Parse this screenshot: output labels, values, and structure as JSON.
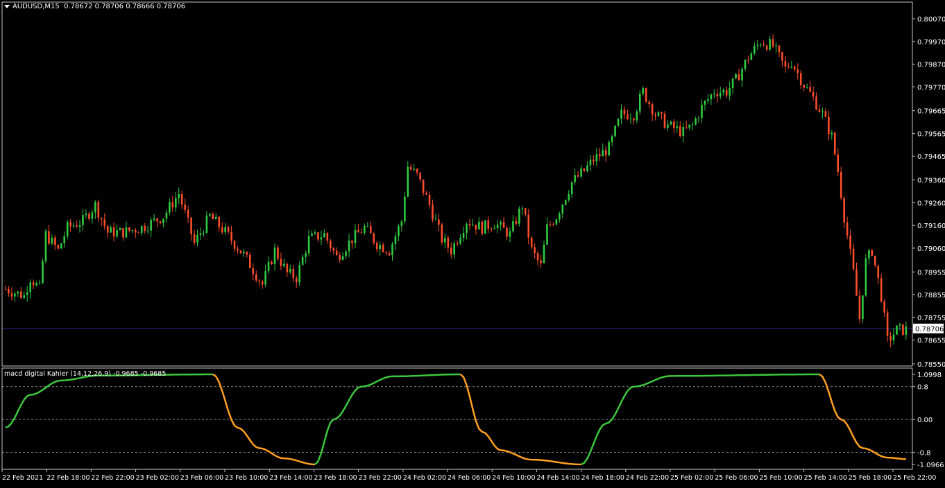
{
  "header": {
    "symbol": "AUDUSD,M15",
    "ohlc": "0.78672 0.78706 0.78666 0.78706"
  },
  "indicator": {
    "label": "macd digital Kahler (14,12,26,9) -0.9685 -0.9685"
  },
  "colors": {
    "background": "#000000",
    "frame": "#c8c8c8",
    "bull_candle": "#2ecc40",
    "bear_candle": "#ff4d2a",
    "price_line": "#2a2a8a",
    "macd_up": "#3cc83c",
    "macd_down": "#ffa020",
    "level_lines": "#8a8a8a"
  },
  "chart_data": [
    {
      "type": "candlestick",
      "title": "AUDUSD,M15",
      "y_ticks": [
        "0.80070",
        "0.79970",
        "0.79870",
        "0.79770",
        "0.79665",
        "0.79565",
        "0.79465",
        "0.79360",
        "0.79260",
        "0.79160",
        "0.79060",
        "0.78955",
        "0.78855",
        "0.78755",
        "0.78655",
        "0.78550"
      ],
      "ylim": [
        0.7855,
        0.8007
      ],
      "current_price": "0.78706",
      "x_ticks": [
        "22 Feb 2021",
        "22 Feb 18:00",
        "22 Feb 22:00",
        "23 Feb 02:00",
        "23 Feb 06:00",
        "23 Feb 10:00",
        "23 Feb 14:00",
        "23 Feb 18:00",
        "23 Feb 22:00",
        "24 Feb 02:00",
        "24 Feb 06:00",
        "24 Feb 10:00",
        "24 Feb 14:00",
        "24 Feb 18:00",
        "24 Feb 22:00",
        "25 Feb 02:00",
        "25 Feb 06:00",
        "25 Feb 10:00",
        "25 Feb 14:00",
        "25 Feb 18:00",
        "25 Feb 22:00"
      ],
      "close_path": [
        [
          0,
          0.7888
        ],
        [
          6,
          0.7885
        ],
        [
          8,
          0.7893
        ],
        [
          11,
          0.7888
        ],
        [
          13,
          0.7912
        ],
        [
          17,
          0.7905
        ],
        [
          20,
          0.7915
        ],
        [
          25,
          0.7918
        ],
        [
          29,
          0.7925
        ],
        [
          33,
          0.7913
        ],
        [
          38,
          0.7913
        ],
        [
          44,
          0.7915
        ],
        [
          51,
          0.792
        ],
        [
          56,
          0.793
        ],
        [
          61,
          0.7908
        ],
        [
          66,
          0.792
        ],
        [
          71,
          0.7913
        ],
        [
          77,
          0.7903
        ],
        [
          83,
          0.789
        ],
        [
          87,
          0.7905
        ],
        [
          91,
          0.7895
        ],
        [
          94,
          0.7893
        ],
        [
          98,
          0.791
        ],
        [
          103,
          0.7912
        ],
        [
          107,
          0.7902
        ],
        [
          112,
          0.791
        ],
        [
          116,
          0.7915
        ],
        [
          120,
          0.7908
        ],
        [
          124,
          0.7905
        ],
        [
          128,
          0.7918
        ],
        [
          130,
          0.7942
        ],
        [
          133,
          0.7938
        ],
        [
          137,
          0.7925
        ],
        [
          141,
          0.791
        ],
        [
          144,
          0.7905
        ],
        [
          149,
          0.7918
        ],
        [
          154,
          0.7915
        ],
        [
          158,
          0.7917
        ],
        [
          163,
          0.7912
        ],
        [
          167,
          0.7925
        ],
        [
          170,
          0.7905
        ],
        [
          173,
          0.7898
        ],
        [
          175,
          0.7915
        ],
        [
          178,
          0.792
        ],
        [
          183,
          0.7935
        ],
        [
          187,
          0.794
        ],
        [
          190,
          0.7945
        ],
        [
          195,
          0.795
        ],
        [
          199,
          0.7965
        ],
        [
          203,
          0.7965
        ],
        [
          206,
          0.7975
        ],
        [
          210,
          0.7965
        ],
        [
          214,
          0.796
        ],
        [
          219,
          0.7957
        ],
        [
          222,
          0.796
        ],
        [
          225,
          0.7968
        ],
        [
          229,
          0.7975
        ],
        [
          233,
          0.7975
        ],
        [
          236,
          0.798
        ],
        [
          240,
          0.799
        ],
        [
          244,
          0.7997
        ],
        [
          248,
          0.7995
        ],
        [
          252,
          0.7985
        ],
        [
          254,
          0.7988
        ],
        [
          258,
          0.7978
        ],
        [
          261,
          0.7972
        ],
        [
          264,
          0.7965
        ],
        [
          267,
          0.7955
        ],
        [
          269,
          0.794
        ],
        [
          271,
          0.792
        ],
        [
          274,
          0.7895
        ],
        [
          276,
          0.7875
        ],
        [
          278,
          0.79
        ],
        [
          280,
          0.7905
        ],
        [
          283,
          0.7885
        ],
        [
          285,
          0.7865
        ],
        [
          288,
          0.787
        ],
        [
          291,
          0.787
        ]
      ]
    },
    {
      "type": "line",
      "title": "macd digital Kahler (14,12,26,9) -0.9685 -0.9685",
      "y_ticks": [
        "1.0998",
        "0.8",
        "0.00",
        "-0.8",
        "-1.0966"
      ],
      "ylim": [
        -1.0966,
        1.0998
      ],
      "levels": [
        0.8,
        0.0,
        -0.8
      ],
      "series": [
        {
          "color_key": "macd_up",
          "x": [
            0,
            8,
            18,
            30,
            67
          ],
          "y": [
            -0.2,
            0.6,
            0.95,
            1.07,
            1.0998
          ]
        },
        {
          "color_key": "macd_down",
          "x": [
            67,
            75,
            82,
            90,
            100
          ],
          "y": [
            1.0998,
            -0.2,
            -0.7,
            -0.95,
            -1.0966
          ]
        },
        {
          "color_key": "macd_up",
          "x": [
            100,
            106,
            115,
            125,
            147
          ],
          "y": [
            -1.0966,
            0.0,
            0.8,
            1.05,
            1.0998
          ]
        },
        {
          "color_key": "macd_down",
          "x": [
            147,
            154,
            160,
            170,
            186
          ],
          "y": [
            1.0998,
            -0.3,
            -0.75,
            -0.98,
            -1.0966
          ]
        },
        {
          "color_key": "macd_up",
          "x": [
            186,
            194,
            203,
            215,
            263
          ],
          "y": [
            -1.0966,
            -0.1,
            0.8,
            1.06,
            1.0998
          ]
        },
        {
          "color_key": "macd_down",
          "x": [
            263,
            270,
            277,
            285,
            291
          ],
          "y": [
            1.0998,
            0.0,
            -0.7,
            -0.93,
            -0.9685
          ]
        }
      ]
    }
  ]
}
